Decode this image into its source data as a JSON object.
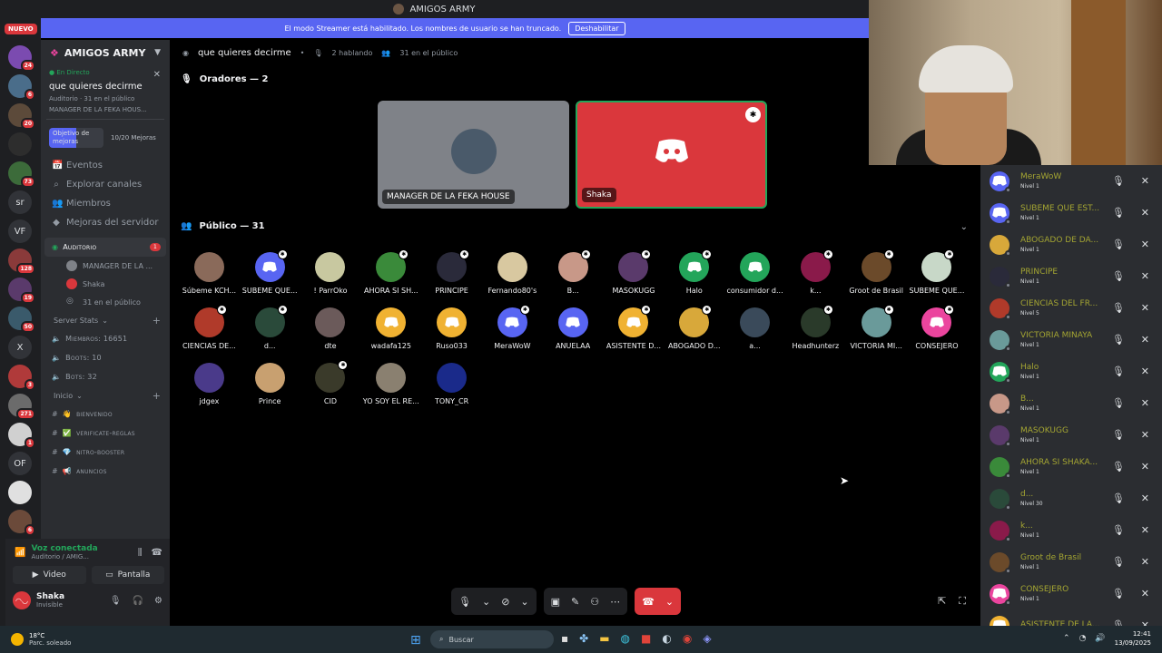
{
  "window": {
    "title": "AMIGOS ARMY"
  },
  "banner": {
    "text": "El modo Streamer está habilitado. Los nombres de usuario se han truncado.",
    "button": "Deshabilitar"
  },
  "rail": {
    "nuevo": "NUEVO",
    "servers": [
      {
        "label": "",
        "color": "#7b4bb0",
        "badge": "24"
      },
      {
        "label": "",
        "color": "#4a6d8a",
        "badge": "6"
      },
      {
        "label": "",
        "color": "#5c4a3a",
        "badge": "20"
      },
      {
        "label": "",
        "color": "#2d2d2d",
        "badge": ""
      },
      {
        "label": "",
        "color": "#3c6b3a",
        "badge": "73"
      },
      {
        "label": "sr",
        "color": "#313338",
        "badge": ""
      },
      {
        "label": "VF",
        "color": "#313338",
        "badge": ""
      },
      {
        "label": "",
        "color": "#8a3a3a",
        "badge": "128"
      },
      {
        "label": "",
        "color": "#5a3a6b",
        "badge": "19"
      },
      {
        "label": "",
        "color": "#3a5a6b",
        "badge": "50"
      },
      {
        "label": "X",
        "color": "#313338",
        "badge": ""
      },
      {
        "label": "",
        "color": "#b03a3a",
        "badge": "3"
      },
      {
        "label": "",
        "color": "#6b6b6b",
        "badge": "271"
      },
      {
        "label": "",
        "color": "#d0d0d0",
        "badge": "1"
      },
      {
        "label": "OF",
        "color": "#313338",
        "badge": ""
      },
      {
        "label": "",
        "color": "#e0e0e0",
        "badge": ""
      },
      {
        "label": "",
        "color": "#6b4a3a",
        "badge": "6"
      }
    ]
  },
  "sidebar": {
    "server_name": "AMIGOS ARMY",
    "live": {
      "badge": "En Directo",
      "title": "que quieres decirme",
      "meta": "Auditorio · 31 en el público",
      "meta2": "MANAGER DE LA FEKA HOUS..."
    },
    "boost": {
      "goal": "Objetivo de mejoras",
      "level": "10/20 Mejoras"
    },
    "nav": [
      "Eventos",
      "Explorar canales",
      "Miembros",
      "Mejoras del servidor"
    ],
    "stage_channel": {
      "name": "Auditorio",
      "mention": "1"
    },
    "stage_members": [
      {
        "name": "MANAGER DE LA ...",
        "color": "#7f8288"
      },
      {
        "name": "Shaka",
        "color": "#da373c"
      },
      {
        "name": "31 en el público",
        "color": ""
      }
    ],
    "server_stats": {
      "label": "Server Stats",
      "items": [
        "Miembros: 16651",
        "Boots: 10",
        "Bots: 32"
      ]
    },
    "inicio": {
      "label": "Inicio",
      "channels": [
        "bienvenido",
        "verificate-reglas",
        "nitro-booster",
        "anuncios"
      ]
    }
  },
  "voice": {
    "status": "Voz conectada",
    "channel": "Auditorio / AMIG...",
    "video": "Video",
    "screen": "Pantalla",
    "user": "Shaka",
    "user_status": "Invisible"
  },
  "stage": {
    "title": "que quieres decirme",
    "speaking": "2 hablando",
    "audience": "31 en el público",
    "speakers_label": "Oradores — 2",
    "speakers": [
      {
        "name": "MANAGER DE LA FEKA HOUSE"
      },
      {
        "name": "Shaka"
      }
    ],
    "audience_label": "Público — 31",
    "members": [
      {
        "name": "Súbeme KCH...",
        "color": "#8a6a5a",
        "discord": false,
        "mod": false
      },
      {
        "name": "SUBEME QUE...",
        "color": "#5865f2",
        "discord": true,
        "mod": true
      },
      {
        "name": "! ParrOko",
        "color": "#c8c8a0",
        "discord": false,
        "mod": false
      },
      {
        "name": "AHORA SI SH...",
        "color": "#3a8a3a",
        "discord": false,
        "mod": true
      },
      {
        "name": "PRINCIPE",
        "color": "#2a2a3a",
        "discord": false,
        "mod": true
      },
      {
        "name": "Fernando80's",
        "color": "#d8c8a0",
        "discord": false,
        "mod": false
      },
      {
        "name": "B...",
        "color": "#c89888",
        "discord": false,
        "mod": true
      },
      {
        "name": "MASOKUGG",
        "color": "#5a3a6b",
        "discord": false,
        "mod": true
      },
      {
        "name": "Halo",
        "color": "#23a55a",
        "discord": true,
        "mod": true
      },
      {
        "name": "consumidor d...",
        "color": "#23a55a",
        "discord": true,
        "mod": false
      },
      {
        "name": "k...",
        "color": "#8a1a4a",
        "discord": false,
        "mod": true
      },
      {
        "name": "Groot de Brasil",
        "color": "#6b4a2a",
        "discord": false,
        "mod": true
      },
      {
        "name": "SUBEME QUE...",
        "color": "#c8d8c8",
        "discord": false,
        "mod": true
      },
      {
        "name": "CIENCIAS DE...",
        "color": "#b03a2a",
        "discord": false,
        "mod": true
      },
      {
        "name": "d...",
        "color": "#2a4a3a",
        "discord": false,
        "mod": true
      },
      {
        "name": "dte",
        "color": "#6b5a5a",
        "discord": false,
        "mod": false
      },
      {
        "name": "wadafa125",
        "color": "#f0b232",
        "discord": true,
        "mod": false
      },
      {
        "name": "Ruso033",
        "color": "#f0b232",
        "discord": true,
        "mod": false
      },
      {
        "name": "MeraWoW",
        "color": "#5865f2",
        "discord": true,
        "mod": true
      },
      {
        "name": "ANUELAA",
        "color": "#5865f2",
        "discord": true,
        "mod": false
      },
      {
        "name": "ASISTENTE D...",
        "color": "#f0b232",
        "discord": true,
        "mod": true
      },
      {
        "name": "ABOGADO D...",
        "color": "#d8a83a",
        "discord": false,
        "mod": true
      },
      {
        "name": "a...",
        "color": "#3a4a5a",
        "discord": false,
        "mod": false
      },
      {
        "name": "Headhunterz",
        "color": "#2a3a2a",
        "discord": false,
        "mod": true
      },
      {
        "name": "VICTORIA MI...",
        "color": "#6a9a9a",
        "discord": false,
        "mod": true
      },
      {
        "name": "CONSEJERO",
        "color": "#eb459e",
        "discord": true,
        "mod": true
      },
      {
        "name": "jdgex",
        "color": "#4a3a8a",
        "discord": false,
        "mod": false
      },
      {
        "name": "Prince",
        "color": "#c8a070",
        "discord": false,
        "mod": false
      },
      {
        "name": "CID",
        "color": "#3a3a2a",
        "discord": false,
        "mod": true
      },
      {
        "name": "YO SOY EL RE...",
        "color": "#8a8070",
        "discord": false,
        "mod": false
      },
      {
        "name": "TONY_CR",
        "color": "#1a2a8a",
        "discord": false,
        "mod": false
      }
    ]
  },
  "right_list": [
    {
      "name": "MeraWoW",
      "level": "Nivel 1",
      "color": "#5865f2",
      "discord": true
    },
    {
      "name": "SUBEME QUE EST...",
      "level": "Nivel 1",
      "color": "#5865f2",
      "discord": true
    },
    {
      "name": "ABOGADO DE DA...",
      "level": "Nivel 1",
      "color": "#d8a83a",
      "discord": false
    },
    {
      "name": "PRINCIPE",
      "level": "Nivel 1",
      "color": "#2a2a3a",
      "discord": false
    },
    {
      "name": "CIENCIAS DEL FR...",
      "level": "Nivel 5",
      "color": "#b03a2a",
      "discord": false
    },
    {
      "name": "VICTORIA MINAYA",
      "level": "Nivel 1",
      "color": "#6a9a9a",
      "discord": false
    },
    {
      "name": "Halo",
      "level": "Nivel 1",
      "color": "#23a55a",
      "discord": true
    },
    {
      "name": "B...",
      "level": "Nivel 1",
      "color": "#c89888",
      "discord": false
    },
    {
      "name": "MASOKUGG",
      "level": "Nivel 1",
      "color": "#5a3a6b",
      "discord": false
    },
    {
      "name": "AHORA SI SHAKA...",
      "level": "Nivel 1",
      "color": "#3a8a3a",
      "discord": false
    },
    {
      "name": "d...",
      "level": "Nivel 30",
      "color": "#2a4a3a",
      "discord": false
    },
    {
      "name": "k...",
      "level": "Nivel 1",
      "color": "#8a1a4a",
      "discord": false
    },
    {
      "name": "Groot de Brasil",
      "level": "Nivel 1",
      "color": "#6b4a2a",
      "discord": false
    },
    {
      "name": "CONSEJERO",
      "level": "Nivel 1",
      "color": "#eb459e",
      "discord": true
    },
    {
      "name": "ASISTENTE DE LA...",
      "level": "",
      "color": "#f0b232",
      "discord": true
    }
  ],
  "taskbar": {
    "temp": "18°C",
    "weather": "Parc. soleado",
    "search": "Buscar",
    "time": "12:41",
    "date": "13/09/2025"
  }
}
